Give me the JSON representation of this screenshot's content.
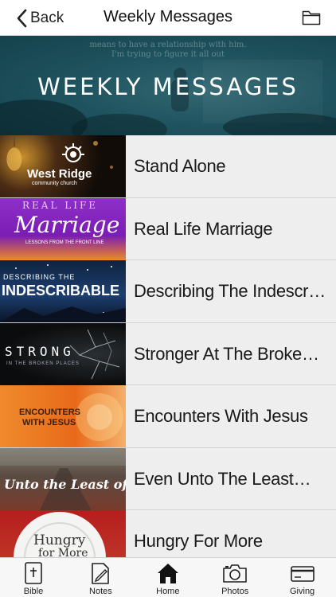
{
  "header": {
    "back_label": "Back",
    "title": "Weekly Messages",
    "back_icon": "chevron-left-icon",
    "folder_icon": "folder-icon"
  },
  "banner": {
    "title": "WEEKLY MESSAGES",
    "quote_line1": "means to have a relationship with him.",
    "quote_line2": "I'm trying to figure it all out"
  },
  "messages": [
    {
      "title": "Stand Alone",
      "thumb_text": "West Ridge",
      "thumb_sub": "community church"
    },
    {
      "title": "Real Life Marriage",
      "thumb_text": "Marriage",
      "thumb_top": "REAL LIFE",
      "thumb_sub": "LESSONS FROM THE FRONT LINE"
    },
    {
      "title": "Describing The Indescr…",
      "thumb_top": "DESCRIBING THE",
      "thumb_text": "INDESCRIBABLE"
    },
    {
      "title": "Stronger At The Broke…",
      "thumb_text": "STRONG",
      "thumb_sub": "IN THE BROKEN PLACES"
    },
    {
      "title": "Encounters With Jesus",
      "thumb_text": "ENCOUNTERS",
      "thumb_sub": "WITH JESUS"
    },
    {
      "title": "Even Unto The Least…",
      "thumb_text": "Unto the Least of"
    },
    {
      "title": "Hungry For More",
      "thumb_text": "Hungry",
      "thumb_sub": "for More"
    }
  ],
  "tabs": [
    {
      "label": "Bible",
      "icon": "bible-icon"
    },
    {
      "label": "Notes",
      "icon": "notes-icon"
    },
    {
      "label": "Home",
      "icon": "home-icon"
    },
    {
      "label": "Photos",
      "icon": "camera-icon"
    },
    {
      "label": "Giving",
      "icon": "credit-card-icon"
    }
  ]
}
